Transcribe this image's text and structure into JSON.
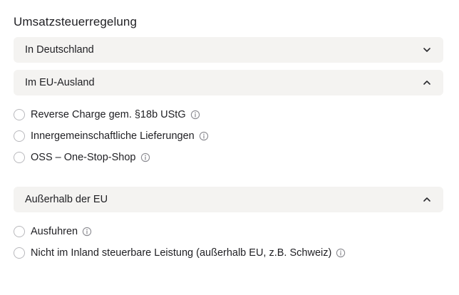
{
  "title": "Umsatzsteuerregelung",
  "sections": [
    {
      "label": "In Deutschland",
      "expanded": false,
      "chevron_icon": "chevron-down-icon",
      "options": []
    },
    {
      "label": "Im EU-Ausland",
      "expanded": true,
      "chevron_icon": "chevron-up-icon",
      "options": [
        {
          "label": "Reverse Charge gem. §18b UStG",
          "selected": false,
          "info_icon": "info-icon"
        },
        {
          "label": "Innergemeinschaftliche Lieferungen",
          "selected": false,
          "info_icon": "info-icon"
        },
        {
          "label": "OSS – One-Stop-Shop",
          "selected": false,
          "info_icon": "info-icon"
        }
      ]
    },
    {
      "label": "Außerhalb der EU",
      "expanded": true,
      "chevron_icon": "chevron-up-icon",
      "options": [
        {
          "label": "Ausfuhren",
          "selected": false,
          "info_icon": "info-icon"
        },
        {
          "label": "Nicht im Inland steuerbare Leistung (außerhalb EU, z.B. Schweiz)",
          "selected": false,
          "info_icon": "info-icon"
        }
      ]
    }
  ]
}
